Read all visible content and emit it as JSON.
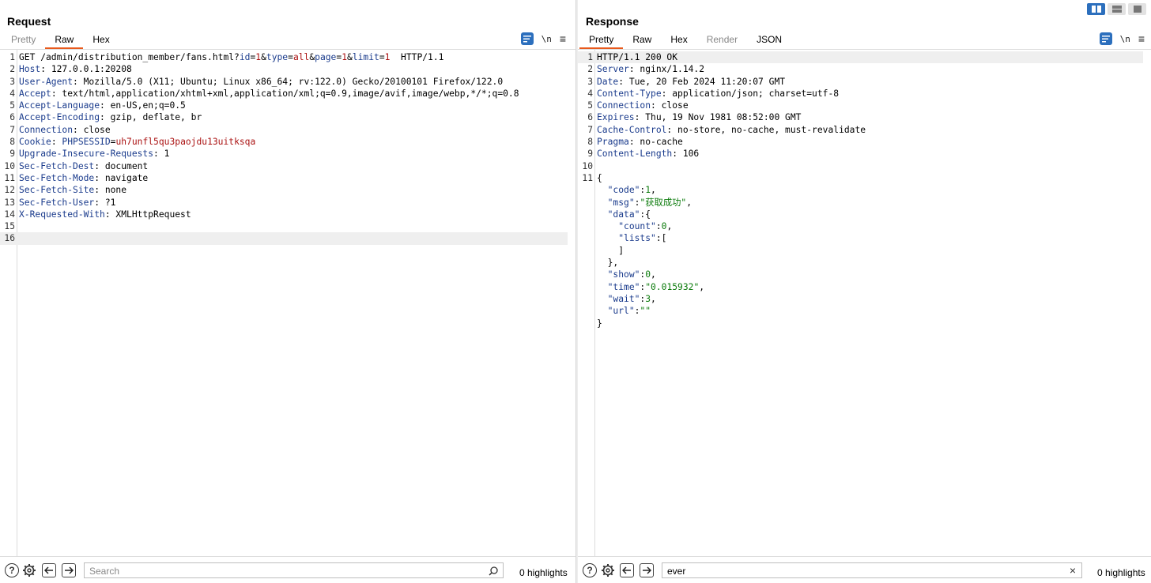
{
  "request": {
    "title": "Request",
    "tabs": [
      {
        "label": "Pretty",
        "state": "dim"
      },
      {
        "label": "Raw",
        "state": "active"
      },
      {
        "label": "Hex",
        "state": "normal"
      }
    ],
    "tool_newline": "\\n",
    "tool_menu": "≡",
    "lines": [
      {
        "n": "1",
        "parts": [
          [
            "",
            "GET /admin/distribution_member/fans.html?"
          ],
          [
            "param",
            "id"
          ],
          [
            "",
            "="
          ],
          [
            "paramv",
            "1"
          ],
          [
            "",
            "&"
          ],
          [
            "param",
            "type"
          ],
          [
            "",
            "="
          ],
          [
            "paramv",
            "all"
          ],
          [
            "",
            "&"
          ],
          [
            "param",
            "page"
          ],
          [
            "",
            "="
          ],
          [
            "paramv",
            "1"
          ],
          [
            "",
            "&"
          ],
          [
            "param",
            "limit"
          ],
          [
            "",
            "="
          ],
          [
            "paramv",
            "1"
          ],
          [
            "",
            "  HTTP/1.1"
          ]
        ]
      },
      {
        "n": "2",
        "parts": [
          [
            "hk",
            "Host"
          ],
          [
            "",
            ": 127.0.0.1:20208"
          ]
        ]
      },
      {
        "n": "3",
        "parts": [
          [
            "hk",
            "User-Agent"
          ],
          [
            "",
            ": Mozilla/5.0 (X11; Ubuntu; Linux x86_64; rv:122.0) Gecko/20100101 Firefox/122.0"
          ]
        ]
      },
      {
        "n": "4",
        "parts": [
          [
            "hk",
            "Accept"
          ],
          [
            "",
            ": text/html,application/xhtml+xml,application/xml;q=0.9,image/avif,image/webp,*/*;q=0.8"
          ]
        ]
      },
      {
        "n": "5",
        "parts": [
          [
            "hk",
            "Accept-Language"
          ],
          [
            "",
            ": en-US,en;q=0.5"
          ]
        ]
      },
      {
        "n": "6",
        "parts": [
          [
            "hk",
            "Accept-Encoding"
          ],
          [
            "",
            ": gzip, deflate, br"
          ]
        ]
      },
      {
        "n": "7",
        "parts": [
          [
            "hk",
            "Connection"
          ],
          [
            "",
            ": close"
          ]
        ]
      },
      {
        "n": "8",
        "parts": [
          [
            "hk",
            "Cookie"
          ],
          [
            "",
            ": "
          ],
          [
            "cookie-k",
            "PHPSESSID"
          ],
          [
            "",
            "="
          ],
          [
            "cookie-v",
            "uh7unfl5qu3paojdu13uitksqa"
          ]
        ]
      },
      {
        "n": "9",
        "parts": [
          [
            "hk",
            "Upgrade-Insecure-Requests"
          ],
          [
            "",
            ": 1"
          ]
        ]
      },
      {
        "n": "10",
        "parts": [
          [
            "hk",
            "Sec-Fetch-Dest"
          ],
          [
            "",
            ": document"
          ]
        ]
      },
      {
        "n": "11",
        "parts": [
          [
            "hk",
            "Sec-Fetch-Mode"
          ],
          [
            "",
            ": navigate"
          ]
        ]
      },
      {
        "n": "12",
        "parts": [
          [
            "hk",
            "Sec-Fetch-Site"
          ],
          [
            "",
            ": none"
          ]
        ]
      },
      {
        "n": "13",
        "parts": [
          [
            "hk",
            "Sec-Fetch-User"
          ],
          [
            "",
            ": ?1"
          ]
        ]
      },
      {
        "n": "14",
        "parts": [
          [
            "hk",
            "X-Requested-With"
          ],
          [
            "",
            ": XMLHttpRequest"
          ]
        ]
      },
      {
        "n": "15",
        "parts": []
      },
      {
        "n": "16",
        "parts": [],
        "current": true
      }
    ],
    "search_placeholder": "Search",
    "search_value": "",
    "highlights": "0 highlights"
  },
  "response": {
    "title": "Response",
    "tabs": [
      {
        "label": "Pretty",
        "state": "active"
      },
      {
        "label": "Raw",
        "state": "normal"
      },
      {
        "label": "Hex",
        "state": "normal"
      },
      {
        "label": "Render",
        "state": "dim"
      },
      {
        "label": "JSON",
        "state": "normal"
      }
    ],
    "tool_newline": "\\n",
    "tool_menu": "≡",
    "lines": [
      {
        "n": "1",
        "parts": [
          [
            "",
            "HTTP/1.1 200 OK"
          ]
        ],
        "current": true
      },
      {
        "n": "2",
        "parts": [
          [
            "hk",
            "Server"
          ],
          [
            "",
            ": nginx/1.14.2"
          ]
        ]
      },
      {
        "n": "3",
        "parts": [
          [
            "hk",
            "Date"
          ],
          [
            "",
            ": Tue, 20 Feb 2024 11:20:07 GMT"
          ]
        ]
      },
      {
        "n": "4",
        "parts": [
          [
            "hk",
            "Content-Type"
          ],
          [
            "",
            ": application/json; charset=utf-8"
          ]
        ]
      },
      {
        "n": "5",
        "parts": [
          [
            "hk",
            "Connection"
          ],
          [
            "",
            ": close"
          ]
        ]
      },
      {
        "n": "6",
        "parts": [
          [
            "hk",
            "Expires"
          ],
          [
            "",
            ": Thu, 19 Nov 1981 08:52:00 GMT"
          ]
        ]
      },
      {
        "n": "7",
        "parts": [
          [
            "hk",
            "Cache-Control"
          ],
          [
            "",
            ": no-store, no-cache, must-revalidate"
          ]
        ]
      },
      {
        "n": "8",
        "parts": [
          [
            "hk",
            "Pragma"
          ],
          [
            "",
            ": no-cache"
          ]
        ]
      },
      {
        "n": "9",
        "parts": [
          [
            "hk",
            "Content-Length"
          ],
          [
            "",
            ": 106"
          ]
        ]
      },
      {
        "n": "10",
        "parts": []
      },
      {
        "n": "11",
        "parts": [
          [
            "",
            "{"
          ]
        ]
      },
      {
        "n": "",
        "parts": [
          [
            "",
            "  "
          ],
          [
            "jk",
            "\"code\""
          ],
          [
            "",
            ":"
          ],
          [
            "jnum",
            "1"
          ],
          [
            "",
            ","
          ]
        ]
      },
      {
        "n": "",
        "parts": [
          [
            "",
            "  "
          ],
          [
            "jk",
            "\"msg\""
          ],
          [
            "",
            ":"
          ],
          [
            "jstr",
            "\"获取成功\""
          ],
          [
            "",
            ","
          ]
        ]
      },
      {
        "n": "",
        "parts": [
          [
            "",
            "  "
          ],
          [
            "jk",
            "\"data\""
          ],
          [
            "",
            ":{"
          ]
        ]
      },
      {
        "n": "",
        "parts": [
          [
            "",
            "    "
          ],
          [
            "jk",
            "\"count\""
          ],
          [
            "",
            ":"
          ],
          [
            "jnum",
            "0"
          ],
          [
            "",
            ","
          ]
        ]
      },
      {
        "n": "",
        "parts": [
          [
            "",
            "    "
          ],
          [
            "jk",
            "\"lists\""
          ],
          [
            "",
            ":["
          ]
        ]
      },
      {
        "n": "",
        "parts": [
          [
            "",
            "    ]"
          ]
        ]
      },
      {
        "n": "",
        "parts": [
          [
            "",
            "  },"
          ]
        ]
      },
      {
        "n": "",
        "parts": [
          [
            "",
            "  "
          ],
          [
            "jk",
            "\"show\""
          ],
          [
            "",
            ":"
          ],
          [
            "jnum",
            "0"
          ],
          [
            "",
            ","
          ]
        ]
      },
      {
        "n": "",
        "parts": [
          [
            "",
            "  "
          ],
          [
            "jk",
            "\"time\""
          ],
          [
            "",
            ":"
          ],
          [
            "jstr",
            "\"0.015932\""
          ],
          [
            "",
            ","
          ]
        ]
      },
      {
        "n": "",
        "parts": [
          [
            "",
            "  "
          ],
          [
            "jk",
            "\"wait\""
          ],
          [
            "",
            ":"
          ],
          [
            "jnum",
            "3"
          ],
          [
            "",
            ","
          ]
        ]
      },
      {
        "n": "",
        "parts": [
          [
            "",
            "  "
          ],
          [
            "jk",
            "\"url\""
          ],
          [
            "",
            ":"
          ],
          [
            "jstr",
            "\"\""
          ]
        ]
      },
      {
        "n": "",
        "parts": [
          [
            "",
            "}"
          ]
        ]
      }
    ],
    "search_placeholder": "",
    "search_value": "ever",
    "clear_icon": "×",
    "highlights": "0 highlights"
  },
  "bottom_icons": {
    "help": "?",
    "settings": "gear-icon",
    "back": "arrow-left-icon",
    "forward": "arrow-right-icon"
  },
  "colors": {
    "accent_blue": "#2c6fbd",
    "active_tab": "#e8591c",
    "header_key": "#1a3b8c",
    "param_value": "#aa1111",
    "json_value": "#0a7a0a"
  }
}
